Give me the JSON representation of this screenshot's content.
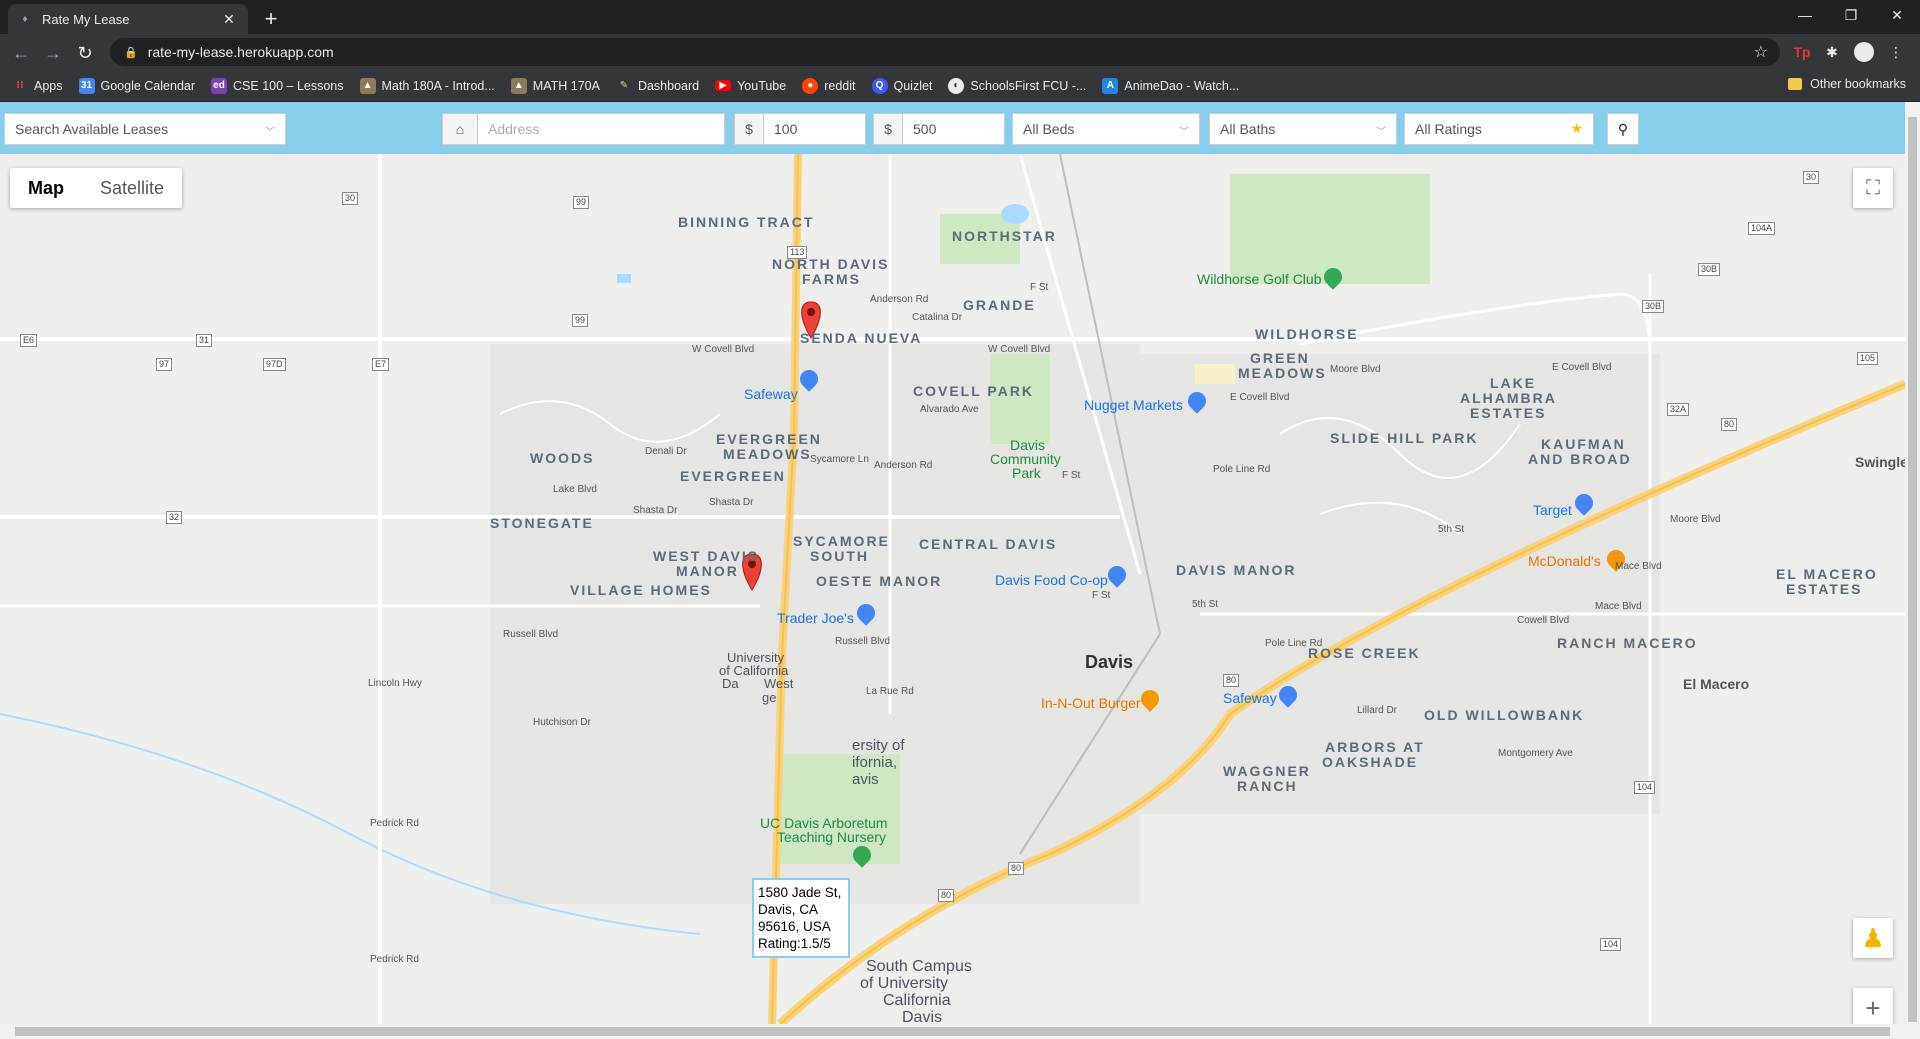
{
  "browser": {
    "tab_title": "Rate My Lease",
    "url": "rate-my-lease.herokuapp.com",
    "bookmarks": [
      "Apps",
      "Google Calendar",
      "CSE 100 – Lessons",
      "Math 180A - Introd...",
      "MATH 170A",
      "Dashboard",
      "YouTube",
      "reddit",
      "Quizlet",
      "SchoolsFirst FCU -...",
      "AnimeDao - Watch..."
    ],
    "other_bookmarks": "Other bookmarks"
  },
  "filters": {
    "lease_select": "Search Available Leases",
    "address_placeholder": "Address",
    "currency_symbol": "$",
    "min_price": "100",
    "max_price": "500",
    "beds": "All Beds",
    "baths": "All Baths",
    "ratings": "All Ratings"
  },
  "map": {
    "type_map": "Map",
    "type_satellite": "Satellite",
    "infowindow": {
      "line1": "1580 Jade St,",
      "line2": "Davis, CA",
      "line3": "95616, USA",
      "line4": "Rating:1.5/5"
    },
    "neighborhoods": [
      "BINNING TRACT",
      "NORTHSTAR",
      "NORTH DAVIS",
      "FARMS",
      "GRANDE",
      "SENDA NUEVA",
      "COVELL PARK",
      "WILDHORSE",
      "GREEN",
      "MEADOWS",
      "LAKE",
      "ALHAMBRA",
      "ESTATES",
      "EVERGREEN",
      "MEADOWS",
      "EVERGREEN",
      "WOODS",
      "SLIDE HILL PARK",
      "KAUFMAN",
      "AND BROAD",
      "STONEGATE",
      "SYCAMORE",
      "SOUTH",
      "CENTRAL DAVIS",
      "WEST DAVIS",
      "MANOR",
      "OESTE MANOR",
      "DAVIS MANOR",
      "VILLAGE HOMES",
      "EL MACERO",
      "ESTATES",
      "ROSE CREEK",
      "RANCH MACERO",
      "OLD WILLOWBANK",
      "ARBORS AT",
      "OAKSHADE",
      "WAGGNER",
      "RANCH"
    ],
    "places": {
      "city": "Davis",
      "el_macero": "El Macero",
      "swingle": "Swingle",
      "wildhorse_golf": "Wildhorse Golf Club",
      "davis_park_1": "Davis",
      "davis_park_2": "Community",
      "davis_park_3": "Park",
      "arboretum_1": "UC Davis Arboretum",
      "arboretum_2": "Teaching Nursery",
      "safeway": "Safeway",
      "nugget": "Nugget Markets",
      "target": "Target",
      "davis_coop": "Davis Food Co-op",
      "trader_joes": "Trader Joe's",
      "mcdonalds": "McDonald's",
      "innout": "In-N-Out Burger",
      "uc_1": "University",
      "uc_2": "of California",
      "uc_3": "Da",
      "uc_4": "West",
      "uc_5": "ge",
      "uc_b1": "ersity of",
      "uc_b2": "ifornia,",
      "uc_b3": "avis",
      "south_1": "South Campus",
      "south_2": "of University",
      "south_3": "California",
      "south_4": "Davis"
    },
    "streets": {
      "w_covell": "W Covell Blvd",
      "w_covell2": "W Covell Blvd",
      "e_covell": "E Covell Blvd",
      "e_covell2": "E Covell Blvd",
      "alvarado": "Alvarado Ave",
      "russell": "Russell Blvd",
      "russell2": "Russell Blvd",
      "hutchison": "Hutchison Dr",
      "fifth": "5th St",
      "fifth2": "5th St",
      "lillard": "Lillard Dr",
      "montgomery": "Montgomery Ave",
      "cowell": "Cowell Blvd",
      "moore": "Moore Blvd",
      "moore2": "Moore Blvd",
      "pole_line": "Pole Line Rd",
      "pole_line2": "Pole Line Rd",
      "mace": "Mace Blvd",
      "mace2": "Mace Blvd",
      "anderson": "Anderson Rd",
      "anderson2": "Anderson Rd",
      "sycamore": "Sycamore Ln",
      "shasta": "Shasta Dr",
      "shasta2": "Shasta Dr",
      "lake": "Lake Blvd",
      "denali": "Denali Dr",
      "catalina": "Catalina Dr",
      "f_st": "F St",
      "f_st2": "F St",
      "f_st3": "F St",
      "la_rue": "La Rue Rd",
      "lincoln": "Lincoln Hwy",
      "pedrick": "Pedrick Rd",
      "pedrick2": "Pedrick Rd"
    },
    "shields": [
      "30",
      "99",
      "E6",
      "31",
      "97",
      "97D",
      "E7",
      "99",
      "113",
      "32",
      "113",
      "80",
      "80",
      "80",
      "80",
      "30",
      "105",
      "104A",
      "30B",
      "30B",
      "105",
      "32A",
      "104",
      "104"
    ]
  }
}
